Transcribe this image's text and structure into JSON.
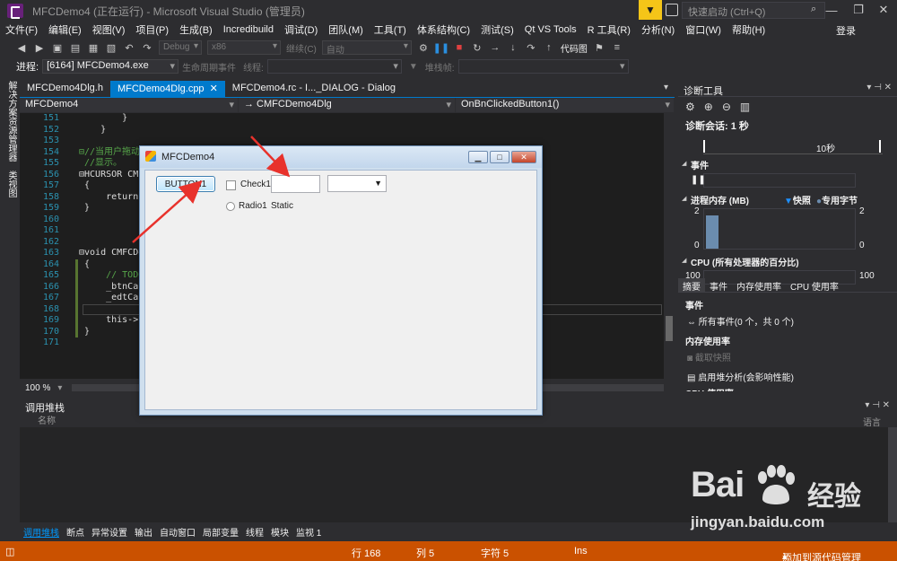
{
  "window": {
    "title": "MFCDemo4 (正在运行) - Microsoft Visual Studio (管理员)",
    "quick_launch_placeholder": "快速启动 (Ctrl+Q)",
    "login": "登录"
  },
  "menu": [
    "文件(F)",
    "编辑(E)",
    "视图(V)",
    "项目(P)",
    "生成(B)",
    "Incredibuild",
    "调试(D)",
    "团队(M)",
    "工具(T)",
    "体系结构(C)",
    "测试(S)",
    "Qt VS Tools",
    "R 工具(R)",
    "分析(N)",
    "窗口(W)",
    "帮助(H)"
  ],
  "toolbar": {
    "config": "Debug",
    "platform": "x86",
    "continue": "继续(C)",
    "auto": "自动",
    "code_map": "代码图"
  },
  "process_bar": {
    "process_label": "进程:",
    "process_value": "[6164] MFCDemo4.exe",
    "lifecycle": "生命周期事件",
    "thread_label": "线程:",
    "stack_frame": "堆栈帧:"
  },
  "left_strip": [
    "解决方案资源管理器",
    "类视图"
  ],
  "doc_tabs": [
    {
      "label": "MFCDemo4Dlg.h",
      "active": false
    },
    {
      "label": "MFCDemo4Dlg.cpp",
      "active": true
    },
    {
      "label": "MFCDemo4.rc - I..._DIALOG - Dialog",
      "active": false
    }
  ],
  "nav": {
    "project": "MFCDemo4",
    "class": "→ CMFCDemo4Dlg",
    "member": "OnBnClickedButton1()"
  },
  "code_lines": [
    {
      "num": "151",
      "text": "        }"
    },
    {
      "num": "152",
      "text": "    }"
    },
    {
      "num": "153",
      "text": ""
    },
    {
      "num": "154",
      "text": "⊟//当用户拖动"
    },
    {
      "num": "155",
      "text": " //显示。"
    },
    {
      "num": "156",
      "text": "⊟HCURSOR CMF"
    },
    {
      "num": "157",
      "text": " {"
    },
    {
      "num": "158",
      "text": "     return"
    },
    {
      "num": "159",
      "text": " }"
    },
    {
      "num": "160",
      "text": ""
    },
    {
      "num": "161",
      "text": ""
    },
    {
      "num": "162",
      "text": ""
    },
    {
      "num": "163",
      "text": "⊟void CMFCDe"
    },
    {
      "num": "164",
      "text": " {"
    },
    {
      "num": "165",
      "text": "     // TODO"
    },
    {
      "num": "166",
      "text": "     _btnCap"
    },
    {
      "num": "167",
      "text": "     _edtCap"
    },
    {
      "num": "168",
      "text": ""
    },
    {
      "num": "169",
      "text": "     this->U"
    },
    {
      "num": "170",
      "text": " }"
    },
    {
      "num": "171",
      "text": ""
    }
  ],
  "zoom": "100 %",
  "diag": {
    "title": "诊断工具",
    "session": "诊断会话: 1 秒",
    "timeline_label": "10秒",
    "events": "事件",
    "process_memory": "进程内存 (MB)",
    "snapshot": "快照",
    "private_bytes": "专用字节",
    "mem_max_left": "2",
    "mem_max_right": "2",
    "mem_min_left": "0",
    "mem_min_right": "0",
    "cpu": "CPU (所有处理器的百分比)",
    "cpu_left": "100",
    "cpu_right": "100",
    "tabs": [
      "摘要",
      "事件",
      "内存使用率",
      "CPU 使用率"
    ],
    "sum_events_hdr": "事件",
    "sum_events_all": "所有事件(0 个，共 0 个)",
    "sum_mem_hdr": "内存使用率",
    "sum_snapshot": "截取快照",
    "sum_heap": "启用堆分析(会影响性能)",
    "sum_cpu_hdr": "CPU 使用率",
    "snapshot_color": "#1e90ff",
    "private_color": "#6b8cae",
    "mem_level": 0.85
  },
  "callstack": {
    "title": "调用堆栈",
    "col_name": "名称",
    "col_lang": "语言"
  },
  "bottom_tabs": [
    "调用堆栈",
    "断点",
    "异常设置",
    "输出",
    "自动窗口",
    "局部变量",
    "线程",
    "模块",
    "监视 1"
  ],
  "status": {
    "line": "行 168",
    "col": "列 5",
    "char": "字符 5",
    "ins": "Ins",
    "source": "添加到源代码管理"
  },
  "dialog": {
    "title": "MFCDemo4",
    "button1": "BUTTON1",
    "check1": "Check1",
    "radio1": "Radio1",
    "static": "Static"
  },
  "watermark": {
    "logo": "Bai",
    "logo_cn": "经验",
    "url": "jingyan.baidu.com"
  }
}
